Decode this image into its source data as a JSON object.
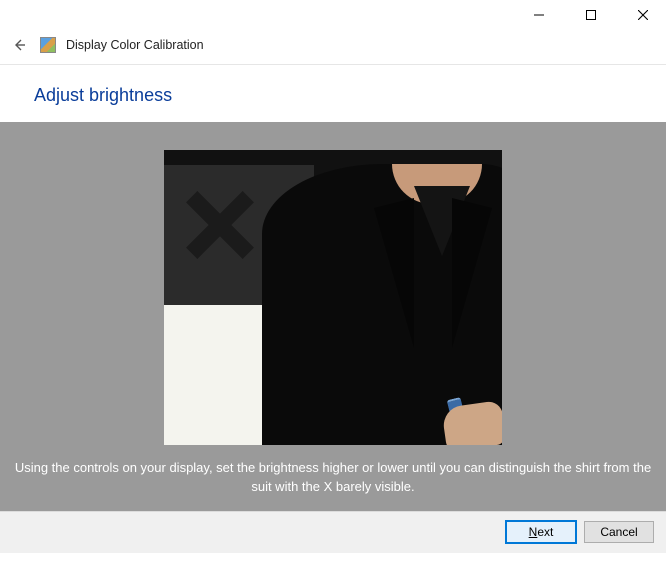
{
  "window": {
    "app_title": "Display Color Calibration"
  },
  "page": {
    "heading": "Adjust brightness",
    "instruction": "Using the controls on your display, set the brightness higher or lower until you can distinguish the shirt from the suit with the X barely visible."
  },
  "footer": {
    "next_prefix": "N",
    "next_suffix": "ext",
    "cancel_label": "Cancel"
  }
}
